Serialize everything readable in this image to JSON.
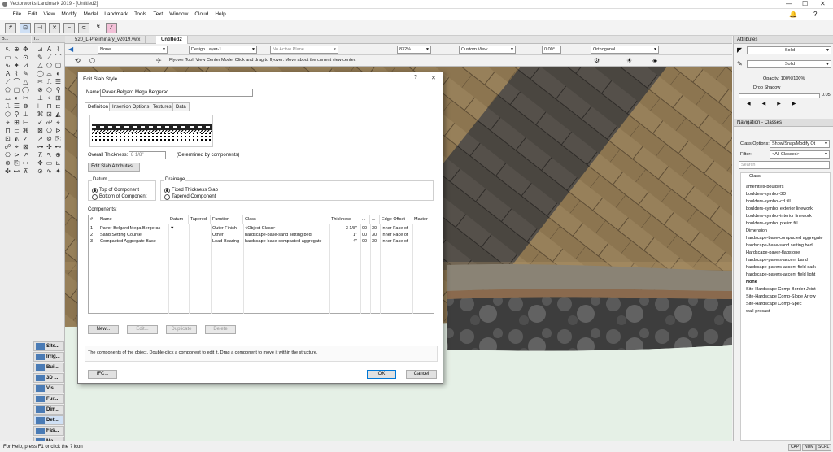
{
  "window": {
    "title": "Vectorworks Landmark 2019 - [Untitled2]",
    "minimize": "—",
    "maximize": "☐",
    "close": "✕"
  },
  "menu": [
    "File",
    "Edit",
    "View",
    "Modify",
    "Model",
    "Landmark",
    "Tools",
    "Text",
    "Window",
    "Cloud",
    "Help"
  ],
  "doc_tabs": [
    "520_L-Preliminary_v2019.vwx",
    "Untitled2"
  ],
  "view_bar": {
    "class": "None",
    "layer": "Design Layer-1",
    "plane": "No Active Plane",
    "zoom": "832%",
    "view": "Custom View",
    "angle": "0.00°",
    "projection": "Orthogonal"
  },
  "tool_hint": "Flyover Tool: View Center Mode. Click and drag to flyover.  Move about the current view center.",
  "left_palettes": {
    "head1": "B...",
    "head2": "T..."
  },
  "tool_sets": [
    "Site...",
    "Irrig...",
    "Buil...",
    "3D ...",
    "Vis...",
    "Fur...",
    "Dim...",
    "Det...",
    "Fas...",
    "Ma..."
  ],
  "attributes": {
    "title": "Attributes",
    "fill": "Solid",
    "pen": "Solid",
    "opacity": "Opacity: 100%/100%",
    "drop_shadow": "Drop Shadow",
    "line_weight": "0.05"
  },
  "navigation": {
    "title": "Navigation - Classes",
    "class_options_label": "Class Options:",
    "class_options_value": "Show/Snap/Modify Ot",
    "filter_label": "Filter:",
    "filter_value": "<All Classes>",
    "search_placeholder": "Search",
    "column": "Class",
    "classes": [
      "amenities-boulders",
      "boulders-symbol-3D",
      "boulders-symbol-cd fill",
      "boulders-symbol exterior linework",
      "boulders-symbol-interior linework",
      "boulders-symbol prelim fill",
      "Dimension",
      "hardscape-base-compacted aggregate",
      "hardscape-base-sand setting bed",
      "Hardscape-paver-flagstone",
      "hardscape-pavers-accent band",
      "hardscape-pavers-accent field dark",
      "hardscape-pavers-accent field light",
      "None",
      "Site-Hardscape Comp-Border Joint",
      "Site-Hardscape Comp-Slope Arrow",
      "Site-Hardscape Comp-Spec",
      "wall-precast"
    ]
  },
  "dialog": {
    "title": "Edit Slab Style",
    "help": "?",
    "close": "✕",
    "name_label": "Name:",
    "name_value": "Paver-Belgard Mega Bergerac",
    "tabs": [
      "Definition",
      "Insertion Options",
      "Textures",
      "Data"
    ],
    "thickness_label": "Overall Thickness:",
    "thickness_value": "8 1/8\"",
    "thickness_note": "(Determined by components)",
    "edit_attr_btn": "Edit Slab Attributes...",
    "datum_label": "Datum",
    "datum_opts": [
      "Top of Component",
      "Bottom of Component"
    ],
    "drainage_label": "Drainage",
    "drainage_opts": [
      "Fixed Thickness Slab",
      "Tapered Component"
    ],
    "components_label": "Components:",
    "columns": [
      "#",
      "Name",
      "Datum",
      "Tapered",
      "Function",
      "Class",
      "Thickness",
      "...",
      "...",
      "Edge Offset",
      "Master"
    ],
    "rows": [
      {
        "num": "1",
        "name": "Paver-Belgard Mega Bergerac",
        "datum": "▼",
        "tapered": "",
        "function": "Outer Finish",
        "class": "<Object Class>",
        "thickness": "3 1/8\"",
        "a": "00",
        "b": "30",
        "edge": "Inner Face of"
      },
      {
        "num": "2",
        "name": "Sand Setting Course",
        "datum": "",
        "tapered": "",
        "function": "Other",
        "class": "hardscape-base-sand setting bed",
        "thickness": "1\"",
        "a": "00",
        "b": "30",
        "edge": "Inner Face of"
      },
      {
        "num": "3",
        "name": "Compacted Aggregate Base",
        "datum": "",
        "tapered": "",
        "function": "Load-Bearing",
        "class": "hardscape-base-compacted aggregate",
        "thickness": "4\"",
        "a": "00",
        "b": "30",
        "edge": "Inner Face of"
      }
    ],
    "buttons": {
      "new": "New...",
      "edit": "Edit...",
      "duplicate": "Duplicate",
      "delete": "Delete",
      "ifc": "IFC...",
      "ok": "OK",
      "cancel": "Cancel"
    },
    "help_text": "The components of the object. Double-click a component to edit it.  Drag a component to move it within the structure."
  },
  "status": {
    "text": "For Help, press F1 or click the ? icon",
    "caps": "CAP",
    "num": "NUM",
    "scrl": "SCRL"
  },
  "colors": {
    "paver_light": "#8c7550",
    "paver_dark": "#4a4640",
    "band": "#8a6a4e",
    "gravel": "#3d3d3d",
    "ground": "#e5f0e6"
  }
}
